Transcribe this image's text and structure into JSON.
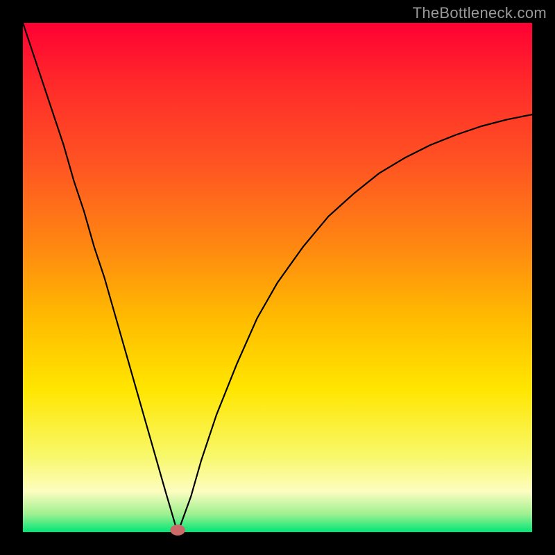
{
  "watermark": "TheBottleneck.com",
  "chart_data": {
    "type": "line",
    "title": "",
    "xlabel": "",
    "ylabel": "",
    "xlim": [
      0,
      100
    ],
    "ylim": [
      0,
      100
    ],
    "grid": false,
    "legend": false,
    "series": [
      {
        "name": "curve",
        "x": [
          0,
          2,
          4,
          6,
          8,
          10,
          12,
          14,
          16,
          18,
          20,
          22,
          24,
          26,
          28,
          30,
          30.5,
          31,
          33,
          35,
          38,
          42,
          46,
          50,
          55,
          60,
          65,
          70,
          75,
          80,
          85,
          90,
          95,
          100
        ],
        "y": [
          100,
          94,
          88,
          82,
          76,
          69,
          63,
          56,
          50,
          43,
          36,
          29,
          22,
          15,
          8,
          1.2,
          0.4,
          1.5,
          7,
          14,
          23,
          33,
          42,
          49,
          56,
          62,
          66.5,
          70.5,
          73.5,
          76,
          78,
          79.7,
          81,
          82
        ]
      }
    ],
    "marker": {
      "x": 30.4,
      "y": 0.4,
      "rx": 1.4,
      "ry": 1.0,
      "color": "#cc6a6a"
    },
    "background_gradient": {
      "stops": [
        {
          "pos": 0.0,
          "color": "#ff0033"
        },
        {
          "pos": 0.12,
          "color": "#ff2a2a"
        },
        {
          "pos": 0.28,
          "color": "#ff5522"
        },
        {
          "pos": 0.44,
          "color": "#ff8811"
        },
        {
          "pos": 0.58,
          "color": "#ffbb00"
        },
        {
          "pos": 0.72,
          "color": "#ffe600"
        },
        {
          "pos": 0.85,
          "color": "#f8f86a"
        },
        {
          "pos": 0.92,
          "color": "#fdfdc0"
        },
        {
          "pos": 0.965,
          "color": "#9df090"
        },
        {
          "pos": 1.0,
          "color": "#00e676"
        }
      ]
    }
  }
}
